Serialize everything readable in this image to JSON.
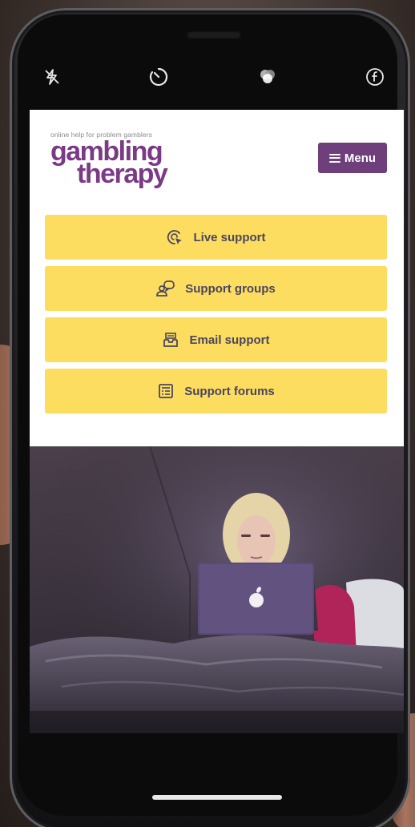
{
  "site": {
    "tagline": "online help for problem gamblers",
    "logo_line1": "gambling",
    "logo_line2": "therapy",
    "menu_label": "Menu"
  },
  "actions": [
    {
      "label": "Live support",
      "icon": "live-chat-cursor-icon"
    },
    {
      "label": "Support groups",
      "icon": "group-chat-icon"
    },
    {
      "label": "Email support",
      "icon": "email-inbox-icon"
    },
    {
      "label": "Support forums",
      "icon": "forum-list-icon"
    }
  ],
  "camera_controls": [
    "flash-off-icon",
    "timer-icon",
    "filters-icon",
    "live-photo-icon"
  ],
  "colors": {
    "brand_purple": "#7a3a86",
    "menu_bg": "#6e3f7a",
    "action_yellow": "#fddd5f",
    "action_text": "#4a4560"
  }
}
